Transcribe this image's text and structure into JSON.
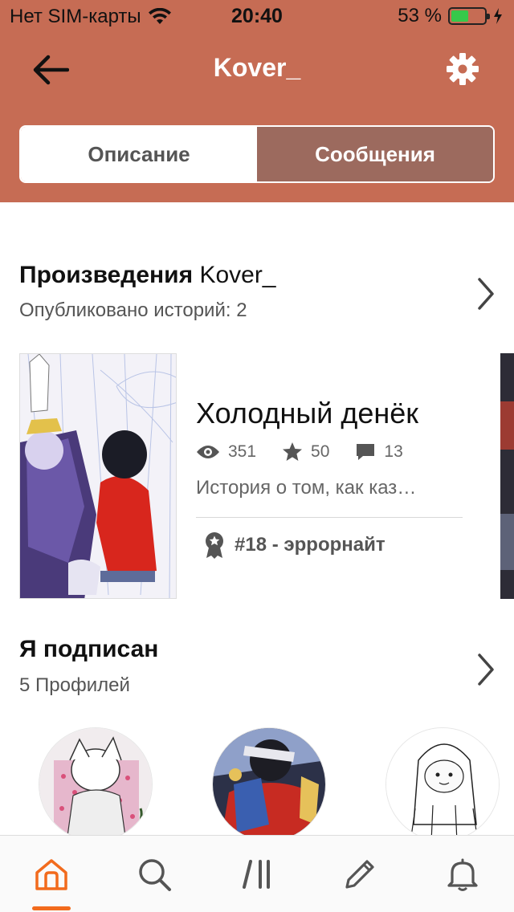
{
  "status_bar": {
    "carrier": "Нет SIM-карты",
    "time": "20:40",
    "battery_percent": "53 %",
    "battery_level": 0.53,
    "battery_color": "#36C94A"
  },
  "header": {
    "title": "Kover_",
    "background": "#C66C54",
    "back_icon": "arrow-left-icon",
    "settings_icon": "gear-icon"
  },
  "segments": {
    "items": [
      {
        "label": "Описание",
        "selected": false
      },
      {
        "label": "Сообщения",
        "selected": true
      }
    ],
    "active_color": "#9C6A5E"
  },
  "works": {
    "title_bold": "Произведения",
    "title_name": "Kover_",
    "subtitle": "Опубликовано историй: 2",
    "story": {
      "title": "Холодный денёк",
      "views": "351",
      "votes": "50",
      "comments": "13",
      "description": "История о том, как каз…",
      "rank": "#18",
      "rank_separator": "-",
      "rank_tag": "эррорнайт"
    }
  },
  "following": {
    "title": "Я подписан",
    "subtitle": "5 Профилей"
  },
  "tabbar": {
    "items": [
      {
        "name": "home",
        "icon": "home-icon",
        "active": true
      },
      {
        "name": "search",
        "icon": "search-icon",
        "active": false
      },
      {
        "name": "library",
        "icon": "library-icon",
        "active": false
      },
      {
        "name": "write",
        "icon": "pencil-icon",
        "active": false
      },
      {
        "name": "notifications",
        "icon": "bell-icon",
        "active": false
      }
    ],
    "accent": "#F26B1D"
  }
}
